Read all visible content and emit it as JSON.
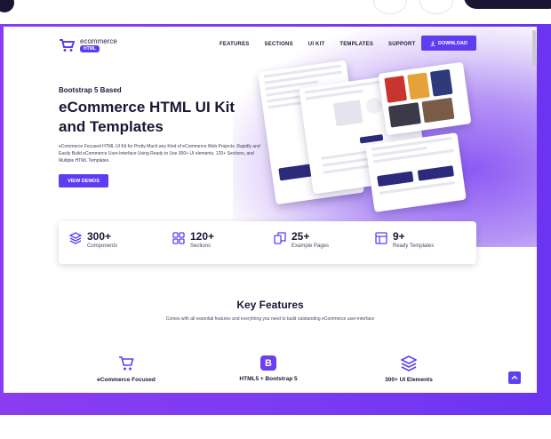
{
  "brand": {
    "name": "ecommerce",
    "badge": "HTML"
  },
  "nav": {
    "items": [
      "FEATURES",
      "SECTIONS",
      "UI KIT",
      "TEMPLATES",
      "SUPPORT"
    ],
    "download_label": "DOWNLOAD"
  },
  "hero": {
    "kicker": "Bootstrap 5 Based",
    "title": "eCommerce HTML UI Kit and Templates",
    "description": "eCommerce Focused HTML UI Kit for Pretty Much any Kind of eCommerce Web Projects. Rapidly and Easily Build eCommerce User-Interface Using Ready to Use 300+ UI elements, 120+ Sections, and Multiple HTML Templates.",
    "cta_label": "VIEW DEMOS"
  },
  "stats": [
    {
      "value": "300+",
      "label": "Components",
      "icon": "layers-icon"
    },
    {
      "value": "120+",
      "label": "Sections",
      "icon": "grid-icon"
    },
    {
      "value": "25+",
      "label": "Example Pages",
      "icon": "pages-icon"
    },
    {
      "value": "9+",
      "label": "Ready Templates",
      "icon": "template-icon"
    }
  ],
  "key_features": {
    "title": "Key Features",
    "subtitle": "Comes with all essential features and everything you need to build outstanding eCommerce user-interface",
    "items": [
      {
        "label": "eCommerce Focused",
        "icon": "cart-icon"
      },
      {
        "label": "HTML5 + Bootstrap 5",
        "icon": "bootstrap-icon",
        "badge": "B"
      },
      {
        "label": "300+ UI Elements",
        "icon": "layers-icon"
      }
    ]
  },
  "colors": {
    "accent": "#5f3ef1",
    "frame": "#7d3cf2",
    "dark": "#1b1634"
  }
}
